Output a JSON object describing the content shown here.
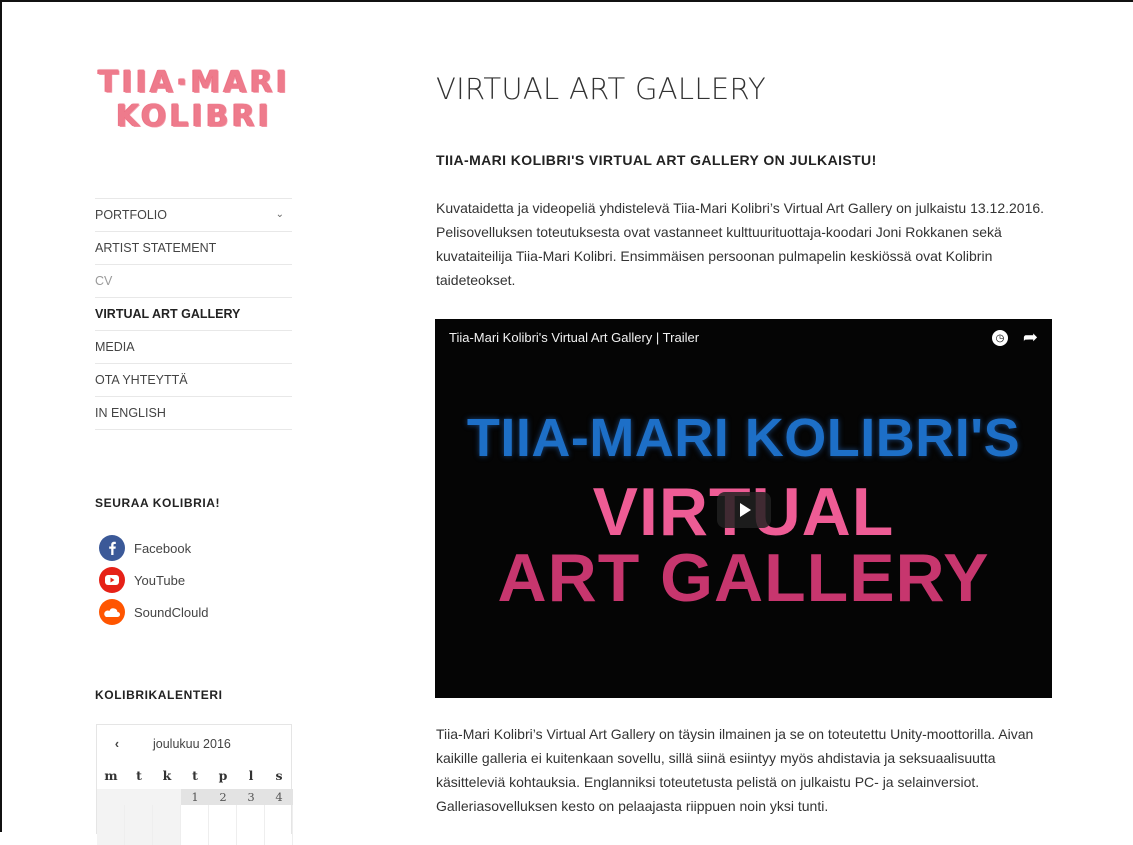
{
  "logo": {
    "line1": "TIIA·MARI",
    "line2": "KOLIBRI"
  },
  "nav": {
    "items": [
      {
        "label": "PORTFOLIO",
        "has_submenu": true
      },
      {
        "label": "ARTIST STATEMENT"
      },
      {
        "label": "CV"
      },
      {
        "label": "VIRTUAL ART GALLERY",
        "active": true
      },
      {
        "label": "MEDIA"
      },
      {
        "label": "OTA YHTEYTTÄ"
      },
      {
        "label": "IN ENGLISH"
      }
    ]
  },
  "follow": {
    "title": "SEURAA KOLIBRIA!",
    "links": [
      {
        "label": "Facebook",
        "icon": "facebook-icon",
        "color": "#3b5998"
      },
      {
        "label": "YouTube",
        "icon": "youtube-icon",
        "color": "#e62117"
      },
      {
        "label": "SoundClould",
        "icon": "soundcloud-icon",
        "color": "#ff5500"
      }
    ]
  },
  "calendar": {
    "title": "KOLIBRIKALENTERI",
    "prev": "‹",
    "month": "joulukuu 2016",
    "weekdays": [
      "m",
      "t",
      "k",
      "t",
      "p",
      "l",
      "s"
    ],
    "first_row": [
      "",
      "",
      "",
      "1",
      "2",
      "3",
      "4"
    ]
  },
  "main": {
    "title": "VIRTUAL ART GALLERY",
    "subheading": "TIIA-MARI KOLIBRI'S VIRTUAL ART GALLERY ON JULKAISTU!",
    "paragraph1": "Kuvataidetta ja videopeliä yhdistelevä Tiia-Mari Kolibri’s Virtual Art Gallery on julkaistu 13.12.2016. Pelisovelluksen toteutuksesta ovat vastanneet kulttuurituottaja-koodari Joni Rokkanen sekä kuvataiteilija Tiia-Mari Kolibri. Ensimmäisen persoonan pulmapelin keskiössä ovat Kolibrin taideteokset.",
    "paragraph2": "Tiia-Mari Kolibri’s Virtual Art Gallery on täysin ilmainen ja se on toteutettu Unity-moottorilla. Aivan kaikille galleria ei kuitenkaan sovellu, sillä siinä esiintyy myös ahdistavia ja seksuaalisuutta käsitteleviä kohtauksia. Englanniksi toteutetusta pelistä on julkaistu PC- ja selainversiot. Galleriasovelluksen kesto on pelaajasta riippuen noin yksi tunti."
  },
  "video": {
    "title": "Tiia-Mari Kolibri's Virtual Art Gallery | Trailer",
    "line1": "TIIA-MARI KOLIBRI'S",
    "line2": "VIRTUAL",
    "line3": "ART GALLERY",
    "colors": {
      "line1": "#1d6fc7",
      "line2": "#ee5c95",
      "line3": "#c7366e"
    }
  }
}
